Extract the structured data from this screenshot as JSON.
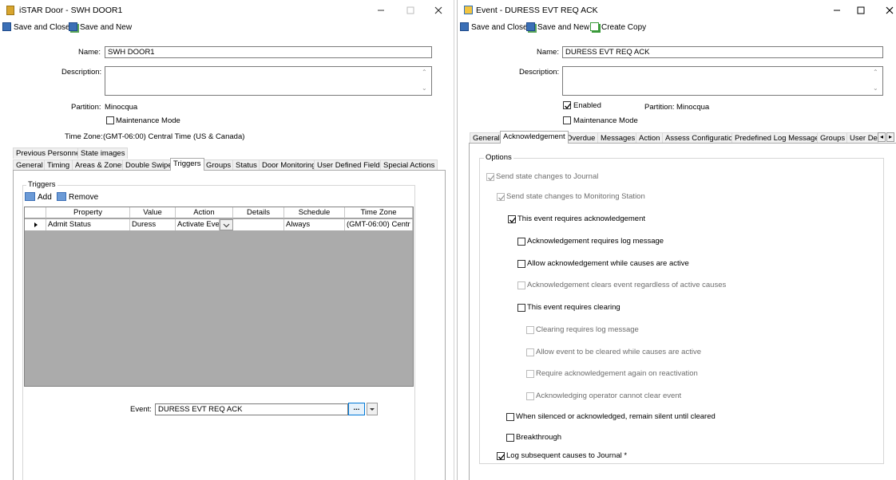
{
  "left": {
    "title": "iSTAR Door  -  SWH DOOR1",
    "toolbar": {
      "save_close": "Save and Close",
      "save_new": "Save and New"
    },
    "fields": {
      "name_label": "Name:",
      "name_value": "SWH DOOR1",
      "description_label": "Description:",
      "description_value": "",
      "partition_label": "Partition:",
      "partition_value": "Minocqua",
      "maintenance_label": "Maintenance Mode",
      "timezone_label": "Time Zone:",
      "timezone_value": "(GMT-06:00) Central Time (US & Canada)"
    },
    "tabs_row1": [
      "Previous Personnel",
      "State images"
    ],
    "tabs_row2": [
      "General",
      "Timing",
      "Areas & Zones",
      "Double Swipe",
      "Triggers",
      "Groups",
      "Status",
      "Door Monitoring",
      "User Defined Fields",
      "Special Actions"
    ],
    "triggers": {
      "group_title": "Triggers",
      "add_label": "Add",
      "remove_label": "Remove",
      "columns": [
        "Property",
        "Value",
        "Action",
        "Details",
        "Schedule",
        "Time Zone"
      ],
      "row": {
        "property": "Admit Status",
        "value": "Duress",
        "action": "Activate Eve",
        "details": "",
        "schedule": "Always",
        "timezone": "(GMT-06:00) Centr"
      },
      "event_label": "Event:",
      "event_value": "DURESS EVT REQ ACK",
      "browse_label": "..."
    }
  },
  "right": {
    "title": "Event  -  DURESS EVT REQ ACK",
    "toolbar": {
      "save_close": "Save and Close",
      "save_new": "Save and New",
      "create_copy": "Create Copy"
    },
    "fields": {
      "name_label": "Name:",
      "name_value": "DURESS EVT REQ ACK",
      "description_label": "Description:",
      "description_value": "",
      "enabled_label": "Enabled",
      "partition_label": "Partition:",
      "partition_value": "Minocqua",
      "maintenance_label": "Maintenance Mode"
    },
    "tabs": [
      "General",
      "Acknowledgement",
      "Overdue",
      "Messages",
      "Action",
      "Assess Configuration",
      "Predefined Log Messages",
      "Groups",
      "User Def"
    ],
    "options": {
      "title": "Options",
      "items": [
        {
          "label": "Send state changes to Journal",
          "checked": true,
          "disabled": true
        },
        {
          "label": "Send state changes to Monitoring Station",
          "checked": true,
          "disabled": true
        },
        {
          "label": "This event requires acknowledgement",
          "checked": true,
          "disabled": false
        },
        {
          "label": "Acknowledgement requires log message",
          "checked": false,
          "disabled": false
        },
        {
          "label": "Allow acknowledgement while causes are active",
          "checked": false,
          "disabled": false
        },
        {
          "label": "Acknowledgement clears event regardless of active causes",
          "checked": false,
          "disabled": true
        },
        {
          "label": "This event requires clearing",
          "checked": false,
          "disabled": false
        },
        {
          "label": "Clearing requires log message",
          "checked": false,
          "disabled": true
        },
        {
          "label": "Allow event to be cleared while causes are active",
          "checked": false,
          "disabled": true
        },
        {
          "label": "Require acknowledgement again on reactivation",
          "checked": false,
          "disabled": true
        },
        {
          "label": "Acknowledging operator cannot clear event",
          "checked": false,
          "disabled": true
        },
        {
          "label": "When silenced or acknowledged, remain silent until cleared",
          "checked": false,
          "disabled": false
        },
        {
          "label": "Breakthrough",
          "checked": false,
          "disabled": false
        },
        {
          "label": "Log subsequent causes to Journal *",
          "checked": true,
          "disabled": false
        }
      ]
    }
  },
  "colors": {
    "accent": "#0078d7",
    "grid_bg": "#ababab",
    "tab_bg": "#f0f0f0",
    "disabled_text": "#6d6d6d"
  }
}
